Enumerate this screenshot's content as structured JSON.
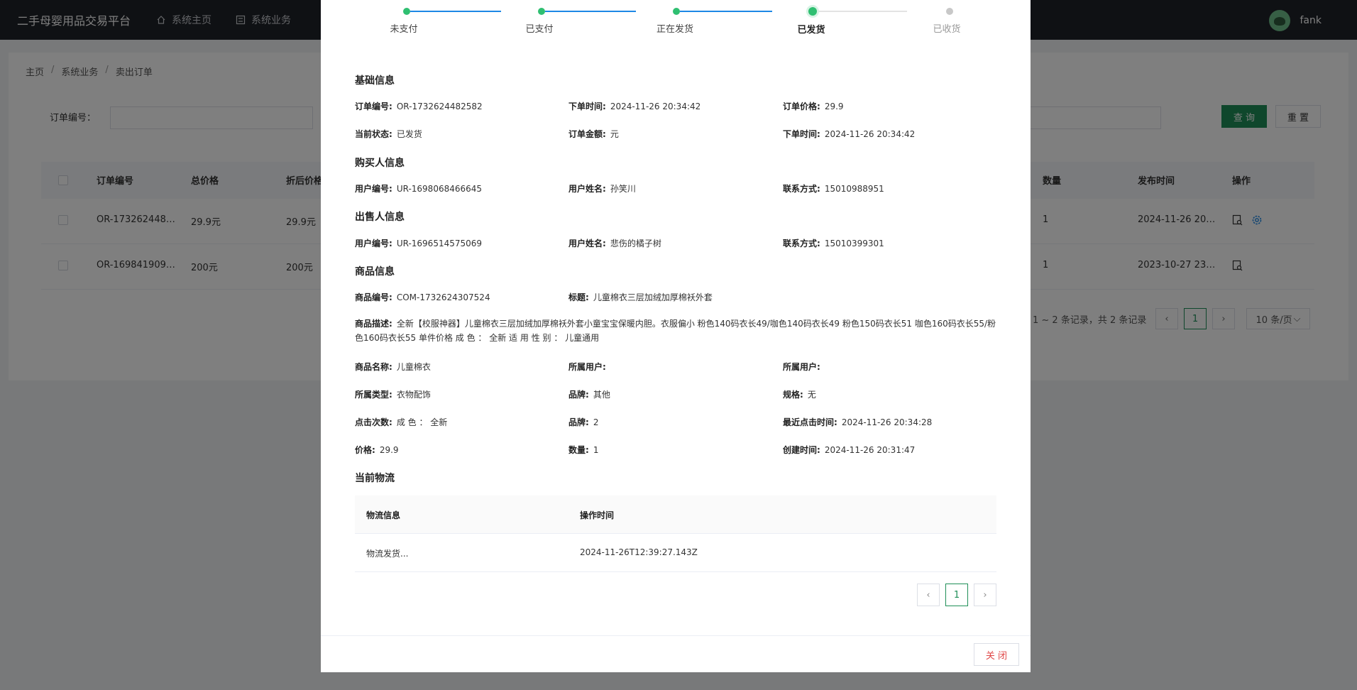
{
  "app": {
    "title": "二手母婴用品交易平台",
    "user": "fank"
  },
  "nav": {
    "home": "系统主页",
    "business": "系统业务"
  },
  "breadcrumb": {
    "b1": "主页",
    "b2": "系统业务",
    "b3": "卖出订单",
    "sep": "/"
  },
  "search": {
    "label": "订单编号：",
    "query": "查 询",
    "reset": "重 置"
  },
  "table": {
    "headers": {
      "order_no": "订单编号",
      "total": "总价格",
      "discount": "折后价格",
      "qty": "数量",
      "publish": "发布时间",
      "ops": "操作"
    },
    "rows": [
      {
        "order_no": "OR-173262448…",
        "total": "29.9元",
        "discount": "29.9元",
        "qty": "1",
        "publish": "2024-11-26 20…"
      },
      {
        "order_no": "OR-169841909…",
        "total": "200元",
        "discount": "200元",
        "qty": "1",
        "publish": "2023-10-27 23…"
      }
    ],
    "pager_text": "1 ~ 2 条记录，共 2 条记录",
    "page": "1",
    "page_size": "10 条/页"
  },
  "modal": {
    "steps": [
      "未支付",
      "已支付",
      "正在发货",
      "已发货",
      "已收货"
    ],
    "current_step_index": 3,
    "basic": {
      "title": "基础信息",
      "order_no_k": "订单编号:",
      "order_no": "OR-1732624482582",
      "order_time_k": "下单时间:",
      "order_time": "2024-11-26 20:34:42",
      "price_k": "订单价格:",
      "price": "29.9",
      "status_k": "当前状态:",
      "status": "已发货",
      "amount_k": "订单金额:",
      "amount": "元",
      "order_time2_k": "下单时间:",
      "order_time2": "2024-11-26 20:34:42"
    },
    "buyer": {
      "title": "购买人信息",
      "uid_k": "用户编号:",
      "uid": "UR-1698068466645",
      "name_k": "用户姓名:",
      "name": "孙笑川",
      "phone_k": "联系方式:",
      "phone": "15010988951"
    },
    "seller": {
      "title": "出售人信息",
      "uid_k": "用户编号:",
      "uid": "UR-1696514575069",
      "name_k": "用户姓名:",
      "name": "悲伤的橘子树",
      "phone_k": "联系方式:",
      "phone": "15010399301"
    },
    "goods": {
      "title": "商品信息",
      "code_k": "商品编号:",
      "code": "COM-1732624307524",
      "title_k": "标题:",
      "title_v": "儿童棉衣三层加绒加厚棉袄外套",
      "desc_k": "商品描述:",
      "desc": "全新【校服神器】儿童棉衣三层加绒加厚棉袄外套小童宝宝保暖内胆。衣服偏小 粉色140码衣长49/咖色140码衣长49 粉色150码衣长51 咖色160码衣长55/粉色160码衣长55 单件价格 成 色 ： 全新 适 用 性 别 ： 儿童通用",
      "name_k": "商品名称:",
      "name": "儿童棉衣",
      "owner_k": "所属用户:",
      "owner": "",
      "owner2_k": "所属用户:",
      "owner2": "",
      "type_k": "所属类型:",
      "type": "衣物配饰",
      "brand_k": "品牌:",
      "brand": "其他",
      "spec_k": "规格:",
      "spec": "无",
      "clicks_k": "点击次数:",
      "clicks": "成 色 ： 全新",
      "brand2_k": "品牌:",
      "brand2": "2",
      "last_click_k": "最近点击时间:",
      "last_click": "2024-11-26 20:34:28",
      "gprice_k": "价格:",
      "gprice": "29.9",
      "gqty_k": "数量:",
      "gqty": "1",
      "created_k": "创建时间:",
      "created": "2024-11-26 20:31:47"
    },
    "logistics": {
      "title": "当前物流",
      "col_info": "物流信息",
      "col_time": "操作时间",
      "row_info": "物流发货...",
      "row_time": "2024-11-26T12:39:27.143Z",
      "page": "1"
    },
    "close": "关 闭"
  },
  "colors": {
    "primary": "#1f8f58",
    "step_done": "#2fbf71",
    "step_line": "#1e88e5",
    "close_text": "#e04848"
  }
}
